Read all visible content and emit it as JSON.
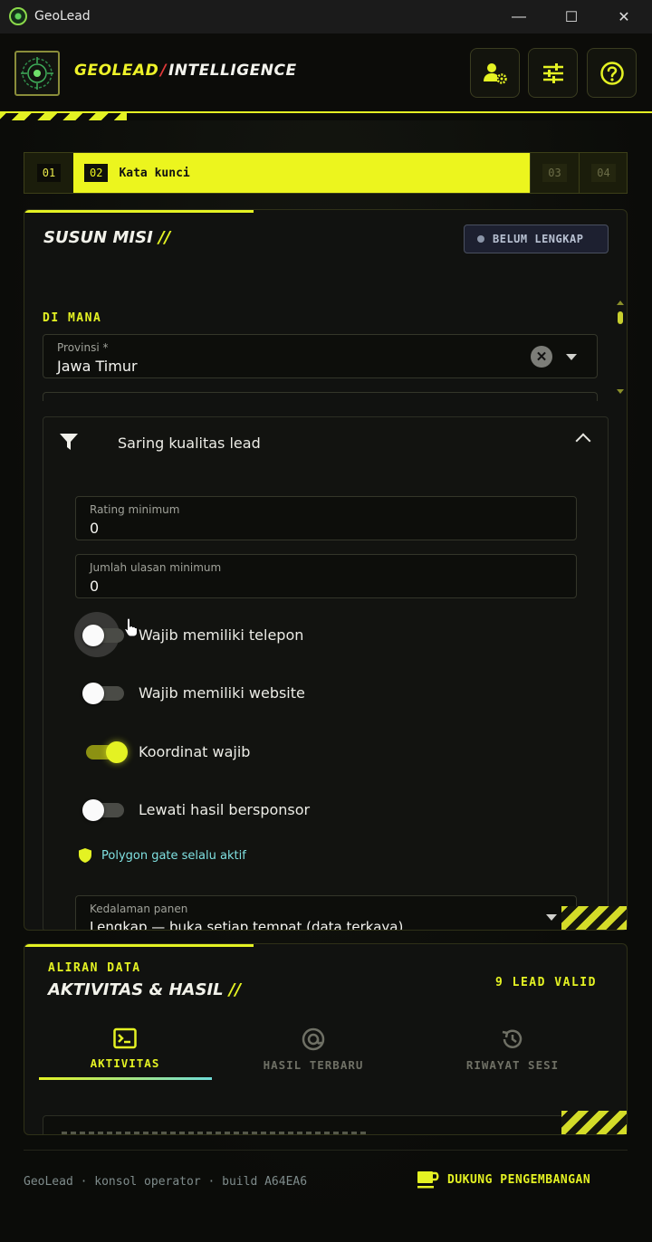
{
  "window": {
    "title": "GeoLead",
    "minimize_glyph": "—",
    "maximize_glyph": "☐",
    "close_glyph": "✕"
  },
  "header": {
    "brand_geo": "GEOLEAD",
    "brand_slash": "/",
    "brand_intel": "INTELLIGENCE",
    "buttons": [
      "user-settings-icon",
      "sliders-icon",
      "help-icon"
    ]
  },
  "steps": [
    {
      "num": "01",
      "label": ""
    },
    {
      "num": "02",
      "label": "Kata kunci"
    },
    {
      "num": "03",
      "label": ""
    },
    {
      "num": "04",
      "label": ""
    }
  ],
  "mission": {
    "title": "SUSUN MISI",
    "title_slash": "//",
    "status": "BELUM LENGKAP",
    "section_label": "DI MANA",
    "province": {
      "label": "Provinsi *",
      "value": "Jawa Timur",
      "clear_glyph": "✕"
    }
  },
  "filter": {
    "title": "Saring kualitas lead",
    "rating": {
      "label": "Rating minimum",
      "value": "0"
    },
    "reviews": {
      "label": "Jumlah ulasan minimum",
      "value": "0"
    },
    "toggles": [
      {
        "label": "Wajib memiliki telepon",
        "on": false
      },
      {
        "label": "Wajib memiliki website",
        "on": false
      },
      {
        "label": "Koordinat wajib",
        "on": true
      },
      {
        "label": "Lewati hasil bersponsor",
        "on": false
      }
    ],
    "polygon_note": "Polygon gate selalu aktif",
    "depth": {
      "label": "Kedalaman panen",
      "value": "Lengkap — buka setiap tempat (data terkaya)"
    }
  },
  "activity": {
    "eyebrow": "ALIRAN DATA",
    "title": "AKTIVITAS & HASIL",
    "title_slash": "//",
    "lead_count": "9 LEAD VALID",
    "tabs": [
      {
        "label": "AKTIVITAS",
        "icon": "terminal-icon",
        "active": true
      },
      {
        "label": "HASIL TERBARU",
        "icon": "at-target-icon",
        "active": false
      },
      {
        "label": "RIWAYAT SESI",
        "icon": "history-icon",
        "active": false
      }
    ]
  },
  "footer": {
    "text": "GeoLead · konsol operator · build A64EA6",
    "support": "DUKUNG PENGEMBANGAN"
  },
  "colors": {
    "accent": "#e4f223",
    "danger": "#e23a3a",
    "info": "#7fe0e0"
  }
}
